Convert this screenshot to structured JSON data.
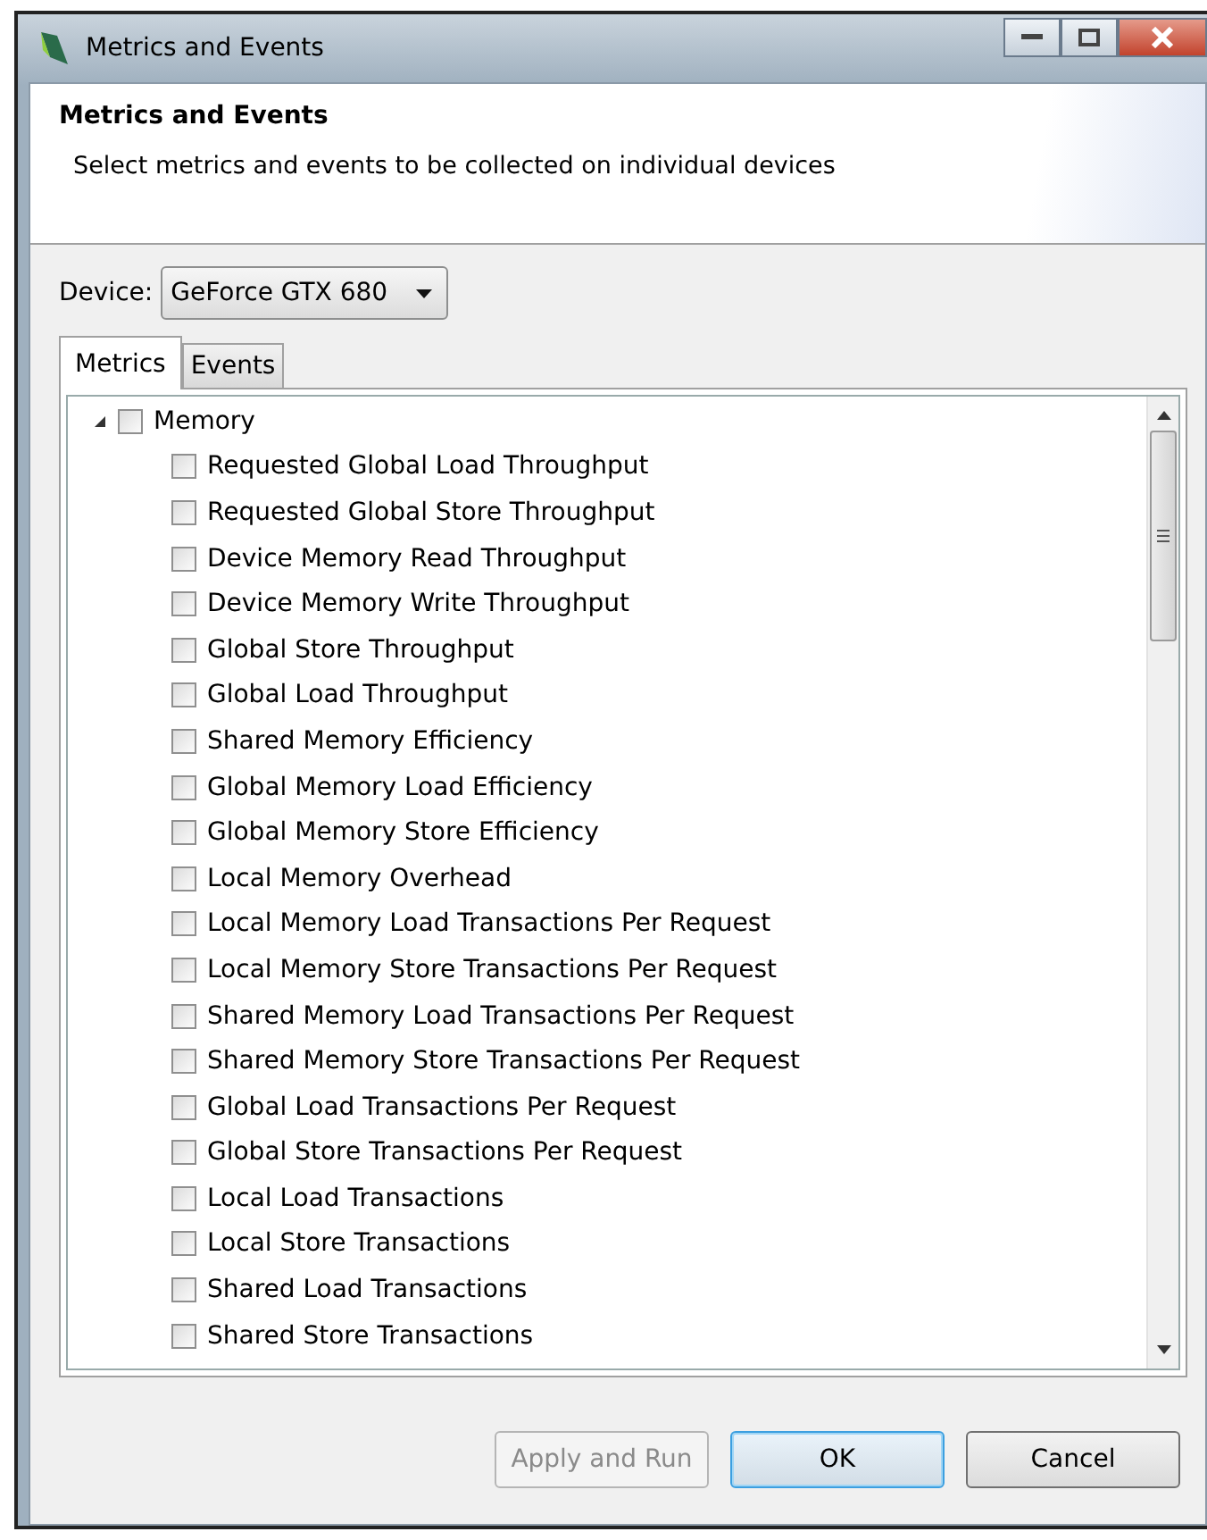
{
  "window": {
    "title": "Metrics and Events"
  },
  "header": {
    "title": "Metrics and Events",
    "description": "Select metrics and events to be collected on individual devices"
  },
  "device": {
    "label": "Device:",
    "value": "GeForce GTX 680"
  },
  "tabs": [
    {
      "label": "Metrics",
      "selected": true
    },
    {
      "label": "Events",
      "selected": false
    }
  ],
  "tree": [
    {
      "label": "Memory",
      "expanded": true,
      "checked": false,
      "children": [
        {
          "label": "Requested Global Load Throughput",
          "checked": false
        },
        {
          "label": "Requested Global Store Throughput",
          "checked": false
        },
        {
          "label": "Device Memory Read Throughput",
          "checked": false
        },
        {
          "label": "Device Memory Write Throughput",
          "checked": false
        },
        {
          "label": "Global Store Throughput",
          "checked": false
        },
        {
          "label": "Global Load Throughput",
          "checked": false
        },
        {
          "label": "Shared Memory Efficiency",
          "checked": false
        },
        {
          "label": "Global Memory Load Efficiency",
          "checked": false
        },
        {
          "label": "Global Memory Store Efficiency",
          "checked": false
        },
        {
          "label": "Local Memory Overhead",
          "checked": false
        },
        {
          "label": "Local Memory Load Transactions Per Request",
          "checked": false
        },
        {
          "label": "Local Memory Store Transactions Per Request",
          "checked": false
        },
        {
          "label": "Shared Memory Load Transactions Per Request",
          "checked": false
        },
        {
          "label": "Shared Memory Store Transactions Per Request",
          "checked": false
        },
        {
          "label": "Global Load Transactions Per Request",
          "checked": false
        },
        {
          "label": "Global Store Transactions Per Request",
          "checked": false
        },
        {
          "label": "Local Load Transactions",
          "checked": false
        },
        {
          "label": "Local Store Transactions",
          "checked": false
        },
        {
          "label": "Shared Load Transactions",
          "checked": false
        },
        {
          "label": "Shared Store Transactions",
          "checked": false
        }
      ]
    }
  ],
  "buttons": [
    {
      "label": "Apply and Run",
      "disabled": true,
      "default": false
    },
    {
      "label": "OK",
      "disabled": false,
      "default": true
    },
    {
      "label": "Cancel",
      "disabled": false,
      "default": false
    }
  ]
}
